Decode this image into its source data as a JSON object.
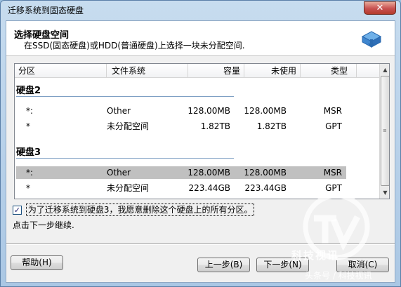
{
  "window": {
    "title": "迁移系统到固态硬盘",
    "close_label": "✕"
  },
  "header": {
    "title": "选择硬盘空间",
    "subtitle": "在SSD(固态硬盘)或HDD(普通硬盘)上选择一块未分配空间."
  },
  "columns": [
    "分区",
    "文件系统",
    "容量",
    "未使用",
    "类型"
  ],
  "groups": [
    {
      "name": "硬盘2",
      "rows": [
        {
          "part": "*:",
          "fs": "Other",
          "cap": "128.00MB",
          "used": "128.00MB",
          "type": "MSR"
        },
        {
          "part": "*",
          "fs": "未分配空间",
          "cap": "1.82TB",
          "used": "1.82TB",
          "type": "GPT"
        }
      ]
    },
    {
      "name": "硬盘3",
      "rows": [
        {
          "part": "*:",
          "fs": "Other",
          "cap": "128.00MB",
          "used": "128.00MB",
          "type": "MSR"
        },
        {
          "part": "*",
          "fs": "未分配空间",
          "cap": "223.44GB",
          "used": "223.44GB",
          "type": "GPT"
        }
      ]
    }
  ],
  "confirm_checkbox": {
    "checked": true,
    "label": "为了迁移系统到硬盘3，我愿意删除这个硬盘上的所有分区。"
  },
  "hint": "点击下一步继续.",
  "buttons": {
    "help": "帮助(H)",
    "back": "上一步(B)",
    "next": "下一步(N)",
    "cancel": "取消(C)"
  },
  "watermark": {
    "text": "科技视讯",
    "footer": "头条号 / 科技视讯"
  }
}
